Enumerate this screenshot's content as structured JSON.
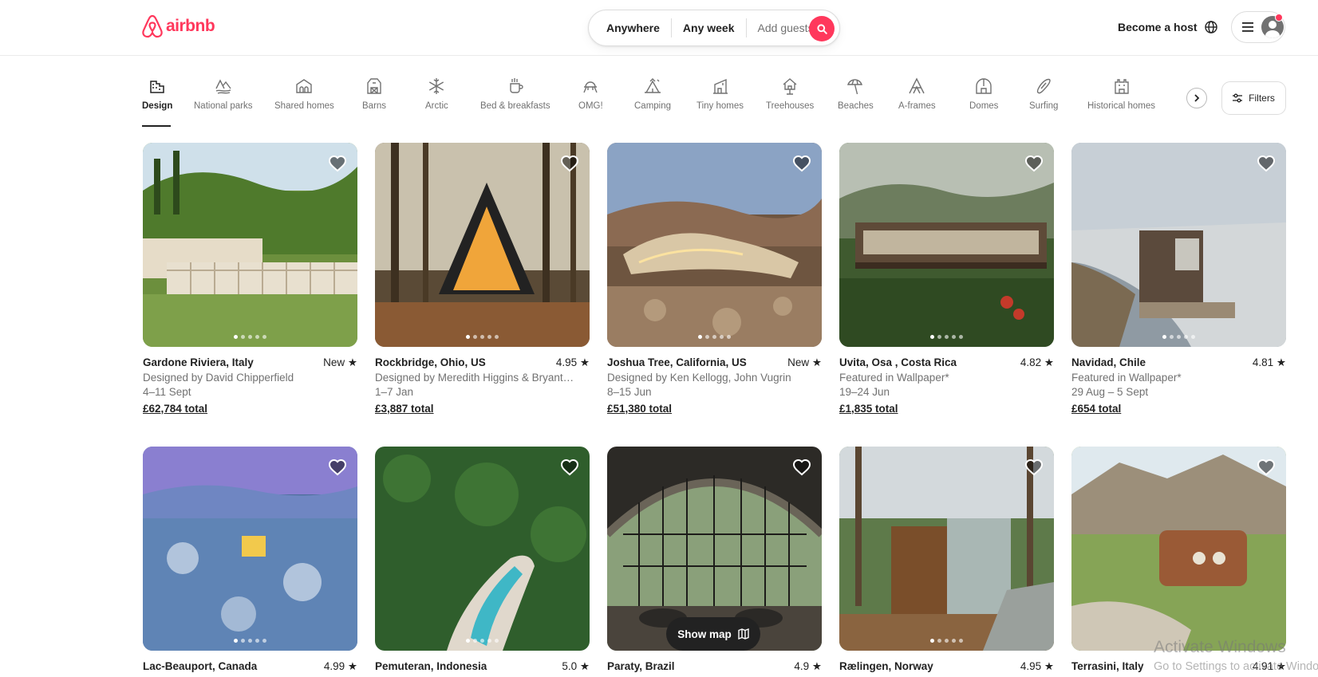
{
  "header": {
    "logo_text": "airbnb",
    "search": {
      "where": "Anywhere",
      "when": "Any week",
      "guests": "Add guests"
    },
    "host_link": "Become a host"
  },
  "categories": [
    {
      "label": "Design",
      "icon": "design-icon",
      "active": true
    },
    {
      "label": "National parks",
      "icon": "national-parks-icon"
    },
    {
      "label": "Shared homes",
      "icon": "shared-homes-icon"
    },
    {
      "label": "Barns",
      "icon": "barns-icon"
    },
    {
      "label": "Arctic",
      "icon": "arctic-icon"
    },
    {
      "label": "Bed & breakfasts",
      "icon": "bed-breakfast-icon"
    },
    {
      "label": "OMG!",
      "icon": "omg-icon"
    },
    {
      "label": "Camping",
      "icon": "camping-icon"
    },
    {
      "label": "Tiny homes",
      "icon": "tiny-homes-icon"
    },
    {
      "label": "Treehouses",
      "icon": "treehouses-icon"
    },
    {
      "label": "Beaches",
      "icon": "beaches-icon"
    },
    {
      "label": "A-frames",
      "icon": "a-frames-icon"
    },
    {
      "label": "Domes",
      "icon": "domes-icon"
    },
    {
      "label": "Surfing",
      "icon": "surfing-icon"
    },
    {
      "label": "Historical homes",
      "icon": "historical-homes-icon"
    }
  ],
  "filters_label": "Filters",
  "listings": [
    {
      "location": "Gardone Riviera, Italy",
      "rating": "New",
      "host": "Designed by David Chipperfield",
      "dates": "4–11 Sept",
      "price": "£62,784 total"
    },
    {
      "location": "Rockbridge, Ohio, US",
      "rating": "4.95",
      "host": "Designed by Meredith Higgins & Bryant…",
      "dates": "1–7 Jan",
      "price": "£3,887 total"
    },
    {
      "location": "Joshua Tree, California, US",
      "rating": "New",
      "host": "Designed by Ken Kellogg, John Vugrin",
      "dates": "8–15 Jun",
      "price": "£51,380 total"
    },
    {
      "location": "Uvita, Osa , Costa Rica",
      "rating": "4.82",
      "host": "Featured in Wallpaper*",
      "dates": "19–24 Jun",
      "price": "£1,835 total"
    },
    {
      "location": "Navidad, Chile",
      "rating": "4.81",
      "host": "Featured in Wallpaper*",
      "dates": "29 Aug – 5 Sept",
      "price": "£654 total"
    },
    {
      "location": "Lac-Beauport, Canada",
      "rating": "4.99"
    },
    {
      "location": "Pemuteran, Indonesia",
      "rating": "5.0"
    },
    {
      "location": "Paraty, Brazil",
      "rating": "4.9"
    },
    {
      "location": "Rælingen, Norway",
      "rating": "4.95"
    },
    {
      "location": "Terrasini, Italy",
      "rating": "4.91"
    }
  ],
  "show_map_label": "Show map",
  "os_watermark": {
    "line1": "Activate Windows",
    "line2": "Go to Settings to activate Windows."
  },
  "colors": {
    "brand": "#ff385c",
    "text": "#222222",
    "muted": "#717171"
  }
}
